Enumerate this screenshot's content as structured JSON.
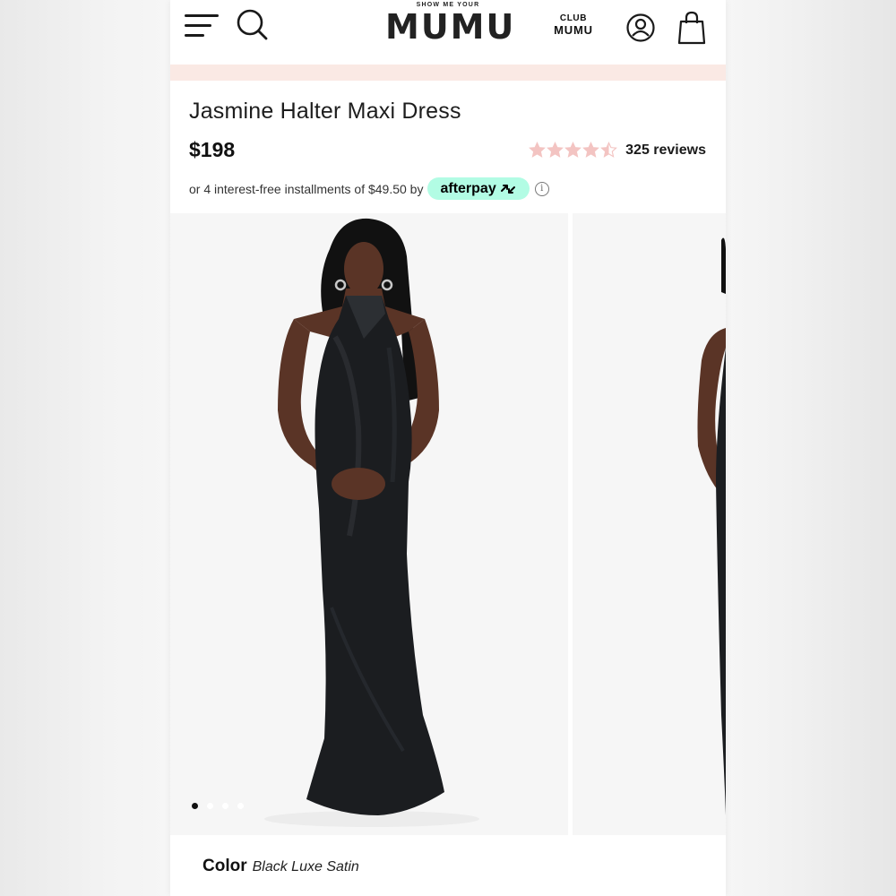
{
  "header": {
    "brand_top": "SHOW ME YOUR",
    "brand_main": "MUMU",
    "club_line1": "CLUB",
    "club_line2": "MUMU",
    "icons": [
      "menu-icon",
      "search-icon",
      "account-icon",
      "shopping-bag-icon"
    ]
  },
  "product": {
    "title": "Jasmine Halter Maxi Dress",
    "price": "$198",
    "rating": 4.5,
    "rating_max": 5,
    "reviews_label": "325 reviews",
    "afterpay_text": "or 4 interest-free installments of $49.50 by",
    "afterpay_brand": "afterpay"
  },
  "gallery": {
    "slide_count": 4,
    "active_slide": 1
  },
  "color": {
    "label": "Color",
    "value": "Black Luxe Satin"
  },
  "colors": {
    "promo_strip": "#fae9e4",
    "star": "#f3c4c2",
    "afterpay_mint": "#b2fce4",
    "dress": "#1b1d20",
    "skin": "#5a3426",
    "dot_active": "#111111",
    "dot_inactive": "#ffffff"
  }
}
